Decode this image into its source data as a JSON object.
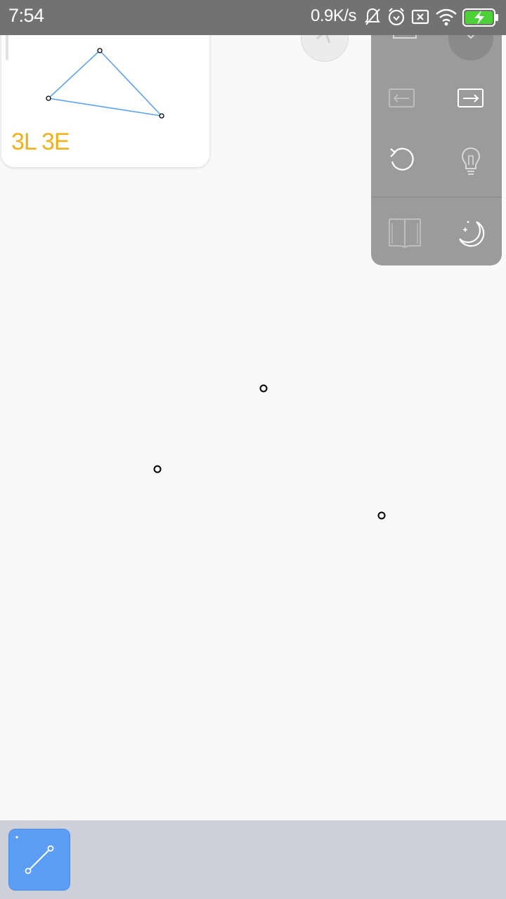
{
  "status_bar": {
    "time": "7:54",
    "network_speed": "0.9K/s",
    "battery_color": "#4cd137",
    "icons": [
      "bell-muted-icon",
      "alarm-icon",
      "sim-x-icon",
      "wifi-icon",
      "battery-charging-icon"
    ]
  },
  "goal": {
    "text": "3L 3E",
    "text_color": "#f0b21c",
    "line_color": "#5aa2ee"
  },
  "menu": {
    "items": [
      "copy-icon",
      "close-icon",
      "undo-arrow-icon",
      "redo-arrow-icon",
      "restart-icon",
      "hint-bulb-icon",
      "book-icon",
      "night-mode-icon"
    ]
  },
  "toolbar": {
    "selected_tool": "line-tool-icon",
    "tool_color": "#5c9ef5"
  }
}
